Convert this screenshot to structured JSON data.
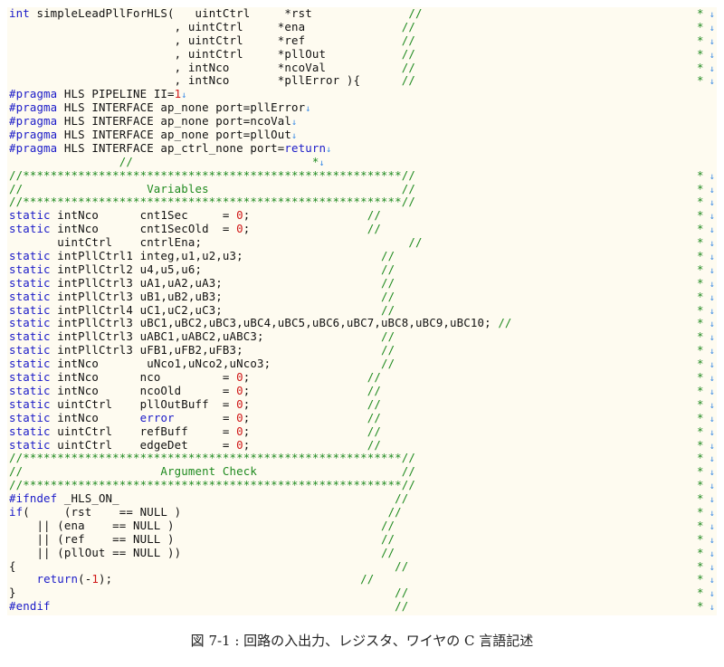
{
  "figure_caption": "図 7-1 : 回路の入出力、レジスタ、ワイヤの C 言語記述",
  "colors": {
    "background": "#fefbf0",
    "keyword": "#1a1ac8",
    "number": "#d01818",
    "comment": "#1f8a1f",
    "eol_marker": "#3c8ce6"
  },
  "icons": {
    "eol_marker": "down-arrow-icon",
    "right_margin_marker": "asterisk"
  },
  "code_lines": [
    [
      [
        "k",
        "int"
      ],
      [
        "t",
        " simpleLeadPllForHLS(   uintCtrl     *rst              "
      ],
      [
        "c",
        "//"
      ]
    ],
    [
      [
        "t",
        "                        , uintCtrl     *ena              "
      ],
      [
        "c",
        "//"
      ]
    ],
    [
      [
        "t",
        "                        , uintCtrl     *ref              "
      ],
      [
        "c",
        "//"
      ]
    ],
    [
      [
        "t",
        "                        , uintCtrl     *pllOut           "
      ],
      [
        "c",
        "//"
      ]
    ],
    [
      [
        "t",
        "                        , intNco       *ncoVal           "
      ],
      [
        "c",
        "//"
      ]
    ],
    [
      [
        "t",
        "                        , intNco       *pllError ){      "
      ],
      [
        "c",
        "//"
      ]
    ],
    [
      [
        "pp",
        "#pragma"
      ],
      [
        "t",
        " HLS PIPELINE II="
      ],
      [
        "n",
        "1"
      ],
      [
        "eol",
        "↓"
      ]
    ],
    [
      [
        "pp",
        "#pragma"
      ],
      [
        "t",
        " HLS INTERFACE ap_none port=pllError"
      ],
      [
        "eol",
        "↓"
      ]
    ],
    [
      [
        "pp",
        "#pragma"
      ],
      [
        "t",
        " HLS INTERFACE ap_none port=ncoVal"
      ],
      [
        "eol",
        "↓"
      ]
    ],
    [
      [
        "pp",
        "#pragma"
      ],
      [
        "t",
        " HLS INTERFACE ap_none port=pllOut"
      ],
      [
        "eol",
        "↓"
      ]
    ],
    [
      [
        "pp",
        "#pragma"
      ],
      [
        "t",
        " HLS INTERFACE ap_ctrl_none port="
      ],
      [
        "k",
        "return"
      ],
      [
        "eol",
        "↓"
      ]
    ],
    [
      [
        "t",
        "                "
      ],
      [
        "c",
        "//                          *"
      ],
      [
        "eol",
        "↓"
      ]
    ],
    [
      [
        "c",
        "//*******************************************************//"
      ]
    ],
    [
      [
        "c",
        "//                  Variables                            //"
      ]
    ],
    [
      [
        "c",
        "//*******************************************************//"
      ]
    ],
    [
      [
        "k",
        "static"
      ],
      [
        "t",
        " intNco      cnt1Sec     = "
      ],
      [
        "n",
        "0"
      ],
      [
        "t",
        ";                 "
      ],
      [
        "c",
        "//"
      ]
    ],
    [
      [
        "k",
        "static"
      ],
      [
        "t",
        " intNco      cnt1SecOld  = "
      ],
      [
        "n",
        "0"
      ],
      [
        "t",
        ";                 "
      ],
      [
        "c",
        "//"
      ]
    ],
    [
      [
        "t",
        "       uintCtrl    cntrlEna;                              "
      ],
      [
        "c",
        "//"
      ]
    ],
    [
      [
        "k",
        "static"
      ],
      [
        "t",
        " intPllCtrl1 integ,u1,u2,u3;                    "
      ],
      [
        "c",
        "//"
      ]
    ],
    [
      [
        "k",
        "static"
      ],
      [
        "t",
        " intPllCtrl2 u4,u5,u6;                          "
      ],
      [
        "c",
        "//"
      ]
    ],
    [
      [
        "k",
        "static"
      ],
      [
        "t",
        " intPllCtrl3 uA1,uA2,uA3;                       "
      ],
      [
        "c",
        "//"
      ]
    ],
    [
      [
        "k",
        "static"
      ],
      [
        "t",
        " intPllCtrl3 uB1,uB2,uB3;                       "
      ],
      [
        "c",
        "//"
      ]
    ],
    [
      [
        "k",
        "static"
      ],
      [
        "t",
        " intPllCtrl4 uC1,uC2,uC3;                       "
      ],
      [
        "c",
        "//"
      ]
    ],
    [
      [
        "k",
        "static"
      ],
      [
        "t",
        " intPllCtrl3 uBC1,uBC2,uBC3,uBC4,uBC5,uBC6,uBC7,uBC8,uBC9,uBC10; "
      ],
      [
        "c",
        "//"
      ]
    ],
    [
      [
        "k",
        "static"
      ],
      [
        "t",
        " intPllCtrl3 uABC1,uABC2,uABC3;                 "
      ],
      [
        "c",
        "//"
      ]
    ],
    [
      [
        "k",
        "static"
      ],
      [
        "t",
        " intPllCtrl3 uFB1,uFB2,uFB3;                    "
      ],
      [
        "c",
        "//"
      ]
    ],
    [
      [
        "k",
        "static"
      ],
      [
        "t",
        " intNco       uNco1,uNco2,uNco3;                "
      ],
      [
        "c",
        "//"
      ]
    ],
    [
      [
        "k",
        "static"
      ],
      [
        "t",
        " intNco      nco         = "
      ],
      [
        "n",
        "0"
      ],
      [
        "t",
        ";                 "
      ],
      [
        "c",
        "//"
      ]
    ],
    [
      [
        "k",
        "static"
      ],
      [
        "t",
        " intNco      ncoOld      = "
      ],
      [
        "n",
        "0"
      ],
      [
        "t",
        ";                 "
      ],
      [
        "c",
        "//"
      ]
    ],
    [
      [
        "k",
        "static"
      ],
      [
        "t",
        " uintCtrl    pllOutBuff  = "
      ],
      [
        "n",
        "0"
      ],
      [
        "t",
        ";                 "
      ],
      [
        "c",
        "//"
      ]
    ],
    [
      [
        "k",
        "static"
      ],
      [
        "t",
        " intNco      "
      ],
      [
        "k",
        "error"
      ],
      [
        "t",
        "       = "
      ],
      [
        "n",
        "0"
      ],
      [
        "t",
        ";                 "
      ],
      [
        "c",
        "//"
      ]
    ],
    [
      [
        "k",
        "static"
      ],
      [
        "t",
        " uintCtrl    refBuff     = "
      ],
      [
        "n",
        "0"
      ],
      [
        "t",
        ";                 "
      ],
      [
        "c",
        "//"
      ]
    ],
    [
      [
        "k",
        "static"
      ],
      [
        "t",
        " uintCtrl    edgeDet     = "
      ],
      [
        "n",
        "0"
      ],
      [
        "t",
        ";                 "
      ],
      [
        "c",
        "//"
      ]
    ],
    [
      [
        "c",
        "//*******************************************************//"
      ]
    ],
    [
      [
        "c",
        "//                    Argument Check                     //"
      ]
    ],
    [
      [
        "c",
        "//*******************************************************//"
      ]
    ],
    [
      [
        "pp",
        "#ifndef"
      ],
      [
        "t",
        " _HLS_ON_                                        "
      ],
      [
        "c",
        "//"
      ]
    ],
    [
      [
        "k",
        "if"
      ],
      [
        "t",
        "(     (rst    == NULL )                              "
      ],
      [
        "c",
        "//"
      ]
    ],
    [
      [
        "t",
        "    || (ena    == NULL )                              "
      ],
      [
        "c",
        "//"
      ]
    ],
    [
      [
        "t",
        "    || (ref    == NULL )                              "
      ],
      [
        "c",
        "//"
      ]
    ],
    [
      [
        "t",
        "    || (pllOut == NULL ))                             "
      ],
      [
        "c",
        "//"
      ]
    ],
    [
      [
        "t",
        "{                                                       "
      ],
      [
        "c",
        "//"
      ]
    ],
    [
      [
        "t",
        "    "
      ],
      [
        "k",
        "return"
      ],
      [
        "t",
        "(-"
      ],
      [
        "n",
        "1"
      ],
      [
        "t",
        ");                                    "
      ],
      [
        "c",
        "//"
      ]
    ],
    [
      [
        "t",
        "}                                                       "
      ],
      [
        "c",
        "//"
      ]
    ],
    [
      [
        "pp",
        "#endif"
      ],
      [
        "t",
        "                                                  "
      ],
      [
        "c",
        "//"
      ]
    ],
    [
      [
        "c",
        "//                                                      //"
      ]
    ]
  ],
  "margin_marked_lines": [
    0,
    1,
    2,
    3,
    4,
    5,
    12,
    13,
    14,
    15,
    16,
    17,
    18,
    19,
    20,
    21,
    22,
    23,
    24,
    25,
    26,
    27,
    28,
    29,
    30,
    31,
    32,
    33,
    34,
    35,
    36,
    37,
    38,
    39,
    40,
    41,
    42,
    43,
    44
  ]
}
